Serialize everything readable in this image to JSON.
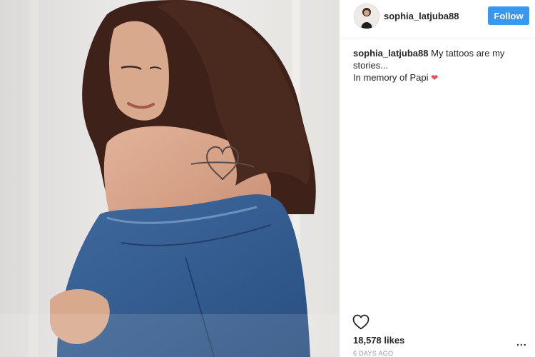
{
  "post": {
    "username": "sophia_latjuba88",
    "follow_label": "Follow",
    "caption_username": "sophia_latjuba88",
    "caption_line1": "My tattoos are my stories...",
    "caption_line2": "In memory of Papi",
    "caption_emoji": "❤",
    "likes": "18,578 likes",
    "more_label": "...",
    "timestamp": "6 DAYS AGO"
  },
  "icons": {
    "like": "heart-outline-icon",
    "more": "more-dots-icon"
  },
  "colors": {
    "follow_button": "#3897f0",
    "heart_emoji": "#ed4956",
    "text": "#262626",
    "muted": "#999999"
  }
}
